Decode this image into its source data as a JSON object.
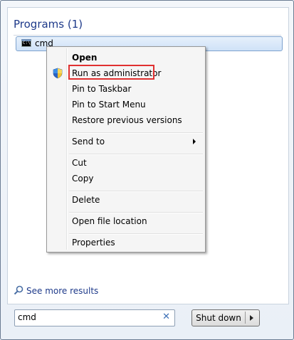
{
  "programs": {
    "title": "Programs (1)",
    "result": {
      "label": "cmd",
      "icon": "cmd-icon"
    }
  },
  "context_menu": {
    "items": [
      {
        "label": "Open",
        "bold": true
      },
      {
        "label": "Run as administrator",
        "icon": "uac-shield-icon",
        "highlighted": true
      },
      {
        "label": "Pin to Taskbar"
      },
      {
        "label": "Pin to Start Menu"
      },
      {
        "label": "Restore previous versions"
      },
      {
        "label": "Send to",
        "submenu": true
      },
      {
        "label": "Cut"
      },
      {
        "label": "Copy"
      },
      {
        "label": "Delete"
      },
      {
        "label": "Open file location"
      },
      {
        "label": "Properties"
      }
    ],
    "highlight_color": "#e03030"
  },
  "see_more": {
    "label": "See more results",
    "icon": "magnifier-icon"
  },
  "search": {
    "value": "cmd",
    "clear_icon": "clear-x-icon"
  },
  "shutdown": {
    "label": "Shut down",
    "icon": "arrow-right-icon"
  }
}
